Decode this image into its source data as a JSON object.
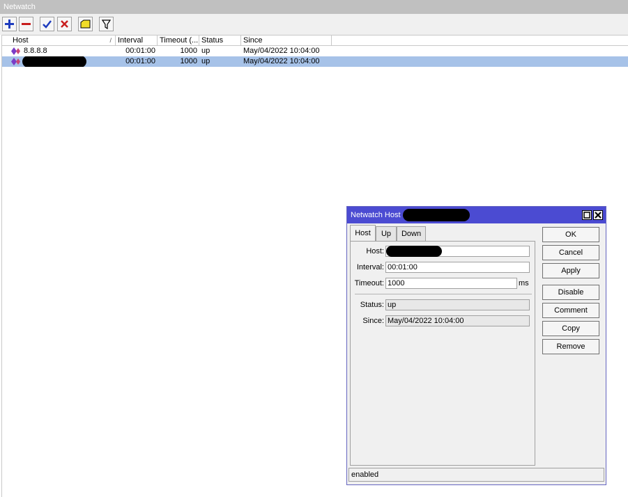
{
  "window": {
    "title": "Netwatch"
  },
  "toolbar": {
    "buttons": [
      {
        "name": "add",
        "icon": "plus-icon",
        "color": "#1e3cbe"
      },
      {
        "name": "remove",
        "icon": "minus-icon",
        "color": "#c81e1e"
      },
      {
        "name": "enable",
        "icon": "checkmark-icon",
        "color": "#1e3cbe"
      },
      {
        "name": "disable",
        "icon": "x-icon",
        "color": "#c81e1e"
      },
      {
        "name": "comment",
        "icon": "note-icon",
        "color": "#f0dc28"
      },
      {
        "name": "filter",
        "icon": "filter-icon",
        "color": "#000000"
      }
    ]
  },
  "table": {
    "columns": [
      "Host",
      "Interval",
      "Timeout (...",
      "Status",
      "Since"
    ],
    "sort_mark": "/",
    "rows": [
      {
        "host": "8.8.8.8",
        "interval": "00:01:00",
        "timeout": "1000",
        "status": "up",
        "since": "May/04/2022 10:04:00",
        "redacted": false
      },
      {
        "host": "",
        "interval": "00:01:00",
        "timeout": "1000",
        "status": "up",
        "since": "May/04/2022 10:04:00",
        "redacted": true
      }
    ]
  },
  "dialog": {
    "title": "Netwatch Host <",
    "tabs": [
      "Host",
      "Up",
      "Down"
    ],
    "active_tab": "Host",
    "fields": {
      "host_label": "Host:",
      "host_value": "",
      "interval_label": "Interval:",
      "interval_value": "00:01:00",
      "timeout_label": "Timeout:",
      "timeout_value": "1000",
      "timeout_unit": "ms",
      "status_label": "Status:",
      "status_value": "up",
      "since_label": "Since:",
      "since_value": "May/04/2022 10:04:00"
    },
    "buttons": {
      "ok": "OK",
      "cancel": "Cancel",
      "apply": "Apply",
      "disable": "Disable",
      "comment": "Comment",
      "copy": "Copy",
      "remove": "Remove"
    },
    "status_bar": "enabled"
  },
  "colors": {
    "selection": "#a6c2e8",
    "dialog_title": "#4b4bd2",
    "window_title": "#c0c0c0"
  }
}
